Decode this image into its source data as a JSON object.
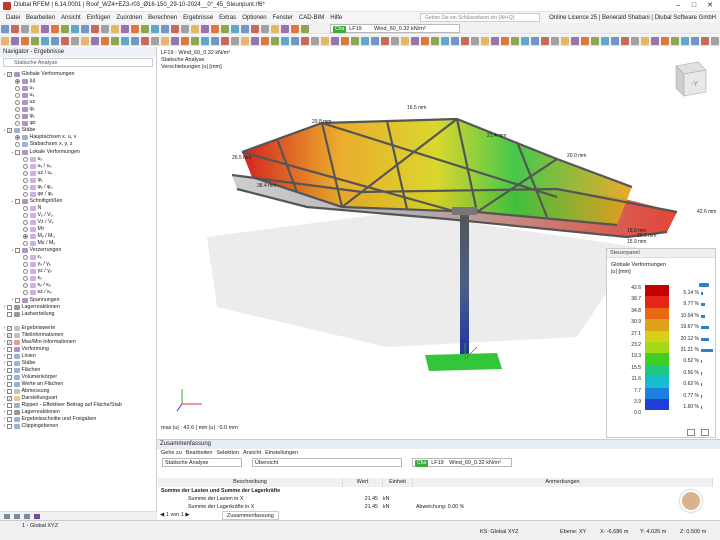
{
  "titlebar": {
    "title": "Dlubal RFEM | 6.14.0001 | Roof_WZ4+EZ3-r03_Ø16-150_29-10-2024__0°_45_Steunpunt.rf6*",
    "search_placeholder": "Geben Sie ein Schlüsselwort ein (Alt+Q)",
    "license": "Online Licence 25 | Benerald Shabani | Dlubal Software GmbH"
  },
  "menu": [
    "Datei",
    "Bearbeiten",
    "Ansicht",
    "Einfügen",
    "Zuordnen",
    "Berechnen",
    "Ergebnisse",
    "Extras",
    "Optionen",
    "Fenster",
    "CAD-BIM",
    "Hilfe"
  ],
  "toolbar": {
    "loadcase_tag": "Cha",
    "loadcase_id": "LF19",
    "loadcase_name": "Wind_60_0.32 kN/m²"
  },
  "navigator": {
    "title": "Navigator - Ergebnisse",
    "subtitle": "Statische Analyse",
    "items": [
      {
        "label": "Globale Verformungen",
        "level": 0,
        "exp": "−",
        "ctrl": "cb",
        "checked": true,
        "icon": "#7a4b9a"
      },
      {
        "label": "|u|",
        "level": 1,
        "ctrl": "rd",
        "checked": true,
        "icon": "#7a4b9a"
      },
      {
        "label": "uₓ",
        "level": 1,
        "ctrl": "rd",
        "checked": false,
        "icon": "#7a4b9a"
      },
      {
        "label": "uᵧ",
        "level": 1,
        "ctrl": "rd",
        "checked": false,
        "icon": "#7a4b9a"
      },
      {
        "label": "uz",
        "level": 1,
        "ctrl": "rd",
        "checked": false,
        "icon": "#7a4b9a"
      },
      {
        "label": "φₓ",
        "level": 1,
        "ctrl": "rd",
        "checked": false,
        "icon": "#7a4b9a"
      },
      {
        "label": "φᵧ",
        "level": 1,
        "ctrl": "rd",
        "checked": false,
        "icon": "#7a4b9a"
      },
      {
        "label": "φz",
        "level": 1,
        "ctrl": "rd",
        "checked": false,
        "icon": "#7a4b9a"
      },
      {
        "label": "Stäbe",
        "level": 0,
        "exp": "−",
        "ctrl": "cb",
        "checked": true,
        "icon": "#5a7fb5"
      },
      {
        "label": "Hauptachsen x, u, v",
        "level": 1,
        "ctrl": "rd",
        "checked": true,
        "icon": "#5a7fb5"
      },
      {
        "label": "Stabachsen x, y, z",
        "level": 1,
        "ctrl": "rd",
        "checked": false,
        "icon": "#5a7fb5"
      },
      {
        "label": "Lokale Verformungen",
        "level": 1,
        "exp": "−",
        "ctrl": "cb",
        "checked": false,
        "icon": "#7a4b9a"
      },
      {
        "label": "uₓ",
        "level": 2,
        "ctrl": "rd",
        "checked": false,
        "icon": "#b07ccf"
      },
      {
        "label": "uᵧ / uᵤ",
        "level": 2,
        "ctrl": "rd",
        "checked": false,
        "icon": "#b07ccf"
      },
      {
        "label": "uz / uᵥ",
        "level": 2,
        "ctrl": "rd",
        "checked": false,
        "icon": "#b07ccf"
      },
      {
        "label": "φₓ",
        "level": 2,
        "ctrl": "rd",
        "checked": false,
        "icon": "#b07ccf"
      },
      {
        "label": "φᵧ / φᵤ",
        "level": 2,
        "ctrl": "rd",
        "checked": false,
        "icon": "#b07ccf"
      },
      {
        "label": "φz / φᵥ",
        "level": 2,
        "ctrl": "rd",
        "checked": false,
        "icon": "#b07ccf"
      },
      {
        "label": "Schnittgrößen",
        "level": 1,
        "exp": "−",
        "ctrl": "cb",
        "checked": false,
        "icon": "#7a4b9a"
      },
      {
        "label": "N",
        "level": 2,
        "ctrl": "rd",
        "checked": false,
        "icon": "#b07ccf"
      },
      {
        "label": "Vᵧ / Vᵤ",
        "level": 2,
        "ctrl": "rd",
        "checked": false,
        "icon": "#b07ccf"
      },
      {
        "label": "Vz / Vᵥ",
        "level": 2,
        "ctrl": "rd",
        "checked": false,
        "icon": "#b07ccf"
      },
      {
        "label": "Mт",
        "level": 2,
        "ctrl": "rd",
        "checked": false,
        "icon": "#b07ccf"
      },
      {
        "label": "Mᵧ / Mᵤ",
        "level": 2,
        "ctrl": "rd",
        "checked": true,
        "icon": "#b07ccf"
      },
      {
        "label": "Mz / Mᵥ",
        "level": 2,
        "ctrl": "rd",
        "checked": false,
        "icon": "#b07ccf"
      },
      {
        "label": "Verzerrungen",
        "level": 1,
        "exp": "−",
        "ctrl": "cb",
        "checked": false,
        "icon": "#7a4b9a"
      },
      {
        "label": "εₓ",
        "level": 2,
        "ctrl": "rd",
        "checked": false,
        "icon": "#b07ccf"
      },
      {
        "label": "γᵧ / γᵤ",
        "level": 2,
        "ctrl": "rd",
        "checked": false,
        "icon": "#b07ccf"
      },
      {
        "label": "γz / γᵥ",
        "level": 2,
        "ctrl": "rd",
        "checked": false,
        "icon": "#b07ccf"
      },
      {
        "label": "κₓ",
        "level": 2,
        "ctrl": "rd",
        "checked": false,
        "icon": "#b07ccf"
      },
      {
        "label": "κᵧ / κᵤ",
        "level": 2,
        "ctrl": "rd",
        "checked": false,
        "icon": "#b07ccf"
      },
      {
        "label": "κz / κᵥ",
        "level": 2,
        "ctrl": "rd",
        "checked": false,
        "icon": "#b07ccf"
      },
      {
        "label": "Spannungen",
        "level": 1,
        "exp": "+",
        "ctrl": "cb",
        "checked": false,
        "icon": "#7a4b9a"
      },
      {
        "label": "Lagerreaktionen",
        "level": 0,
        "exp": "+",
        "ctrl": "cb",
        "checked": false,
        "icon": "#555"
      },
      {
        "label": "Lastverteilung",
        "level": 0,
        "ctrl": "cb",
        "checked": false,
        "icon": "#555"
      },
      {
        "label": "",
        "level": 0,
        "spacer": true
      },
      {
        "label": "Ergebniswerte",
        "level": 0,
        "exp": "+",
        "ctrl": "cb",
        "checked": true,
        "icon": "#999"
      },
      {
        "label": "Titelinformationen",
        "level": 0,
        "exp": "+",
        "ctrl": "cb",
        "checked": true,
        "icon": "#999"
      },
      {
        "label": "Max/Min-Informationen",
        "level": 0,
        "exp": "+",
        "ctrl": "cb",
        "checked": true,
        "icon": "#d9534f"
      },
      {
        "label": "Verformung",
        "level": 0,
        "exp": "+",
        "ctrl": "cb",
        "checked": false,
        "icon": "#7a4b9a"
      },
      {
        "label": "Linien",
        "level": 0,
        "exp": "+",
        "ctrl": "cb",
        "checked": false,
        "icon": "#5a7fb5"
      },
      {
        "label": "Stäbe",
        "level": 0,
        "exp": "+",
        "ctrl": "cb",
        "checked": false,
        "icon": "#5a7fb5"
      },
      {
        "label": "Flächen",
        "level": 0,
        "exp": "+",
        "ctrl": "cb",
        "checked": false,
        "icon": "#5a7fb5"
      },
      {
        "label": "Volumenkörper",
        "level": 0,
        "exp": "+",
        "ctrl": "cb",
        "checked": false,
        "icon": "#5a7fb5"
      },
      {
        "label": "Werte an Flächen",
        "level": 0,
        "exp": "+",
        "ctrl": "cb",
        "checked": false,
        "icon": "#5a7fb5"
      },
      {
        "label": "Abmessung",
        "level": 0,
        "exp": "+",
        "ctrl": "cb",
        "checked": false,
        "icon": "#999"
      },
      {
        "label": "Darstellungsart",
        "level": 0,
        "exp": "+",
        "ctrl": "cb",
        "checked": true,
        "icon": "#e2a33a"
      },
      {
        "label": "Rippen - Effektiver Beitrag auf Fläche/Stab",
        "level": 0,
        "exp": "+",
        "ctrl": "cb",
        "checked": false,
        "icon": "#5a7fb5"
      },
      {
        "label": "Lagerreaktionen",
        "level": 0,
        "exp": "+",
        "ctrl": "cb",
        "checked": false,
        "icon": "#555"
      },
      {
        "label": "Ergebnisschnitte und Freigaben",
        "level": 0,
        "exp": "+",
        "ctrl": "cb",
        "checked": false,
        "icon": "#5a7fb5"
      },
      {
        "label": "Clippingebenen",
        "level": 0,
        "exp": "+",
        "ctrl": "cb",
        "checked": false,
        "icon": "#5a7fb5"
      }
    ]
  },
  "viewport": {
    "line1": "LF19 - Wind_60_0.32 kN/m²",
    "line2": "Statische Analyse",
    "line3": "Verschiebungen |u| [mm]",
    "maxmin": "max |u| : 42.6 | min |u| : 0.0 mm",
    "labels": [
      "29.8 mm",
      "26.5 mm",
      "38.4 mm",
      "42.6 mm",
      "18.8 mm",
      "20.9 mm",
      "15.9 mm",
      "16.5 mm",
      "21.4 mm",
      "20.0 mm"
    ]
  },
  "panel": {
    "title": "Steuerpanel",
    "subtitle": "Globale Verformungen",
    "unit": "|u| [mm]",
    "legend": [
      {
        "v": "42.6",
        "color": "#c40000",
        "p": "5.14 %",
        "f": 0.16
      },
      {
        "v": "38.7",
        "color": "#e8241a",
        "p": "9.77 %",
        "f": 0.31
      },
      {
        "v": "34.8",
        "color": "#e86a10",
        "p": "10.04 %",
        "f": 0.32
      },
      {
        "v": "30.9",
        "color": "#dda218",
        "p": "19.67 %",
        "f": 0.63
      },
      {
        "v": "27.1",
        "color": "#d8cf1a",
        "p": "20.12 %",
        "f": 0.64
      },
      {
        "v": "23.2",
        "color": "#a6d81a",
        "p": "31.21 %",
        "f": 1.0
      },
      {
        "v": "19.3",
        "color": "#3fcf20",
        "p": "0.52 %",
        "f": 0.02
      },
      {
        "v": "15.5",
        "color": "#1ec883",
        "p": "0.56 %",
        "f": 0.02
      },
      {
        "v": "11.6",
        "color": "#18bccf",
        "p": "0.62 %",
        "f": 0.02
      },
      {
        "v": "7.7",
        "color": "#1e7fe0",
        "p": "0.77 %",
        "f": 0.02
      },
      {
        "v": "3.9",
        "color": "#1e3ed8",
        "p": "1.60 %",
        "f": 0.05
      },
      {
        "v": "0.0",
        "color": "#0d1a8a",
        "p": "",
        "f": 0
      }
    ]
  },
  "summary": {
    "title": "Zusammenfassung",
    "menu": [
      "Gehe zu",
      "Bearbeiten",
      "Selektion",
      "Ansicht",
      "Einstellungen"
    ],
    "analysis": "Statische Analyse",
    "view": "Übersicht",
    "lc_tag": "Cha",
    "lc_id": "LF19",
    "lc_name": "Wind_60_0.32 kN/m²",
    "headers": [
      "Beschreibung",
      "Wert",
      "Einheit",
      "Anmerkungen"
    ],
    "section": "Summe der Lasten und Summe der Lagerkräfte",
    "rows": [
      {
        "desc": "Summe der Lasten in X",
        "val": "21.45",
        "unit": "kN",
        "note": ""
      },
      {
        "desc": "Summe der Lagerkräfte in X",
        "val": "21.45",
        "unit": "kN",
        "note": "Abweichung: 0.00 %"
      }
    ],
    "pager": "1 von 1",
    "tab": "Zusammenfassung"
  },
  "status": {
    "cs": "1 - Global XYZ",
    "ks": "KS: Global XYZ",
    "plane": "Ebene: XY",
    "x": "X: -6.686 m",
    "y": "Y: 4.026 m",
    "z": "Z: 0.500 m"
  }
}
